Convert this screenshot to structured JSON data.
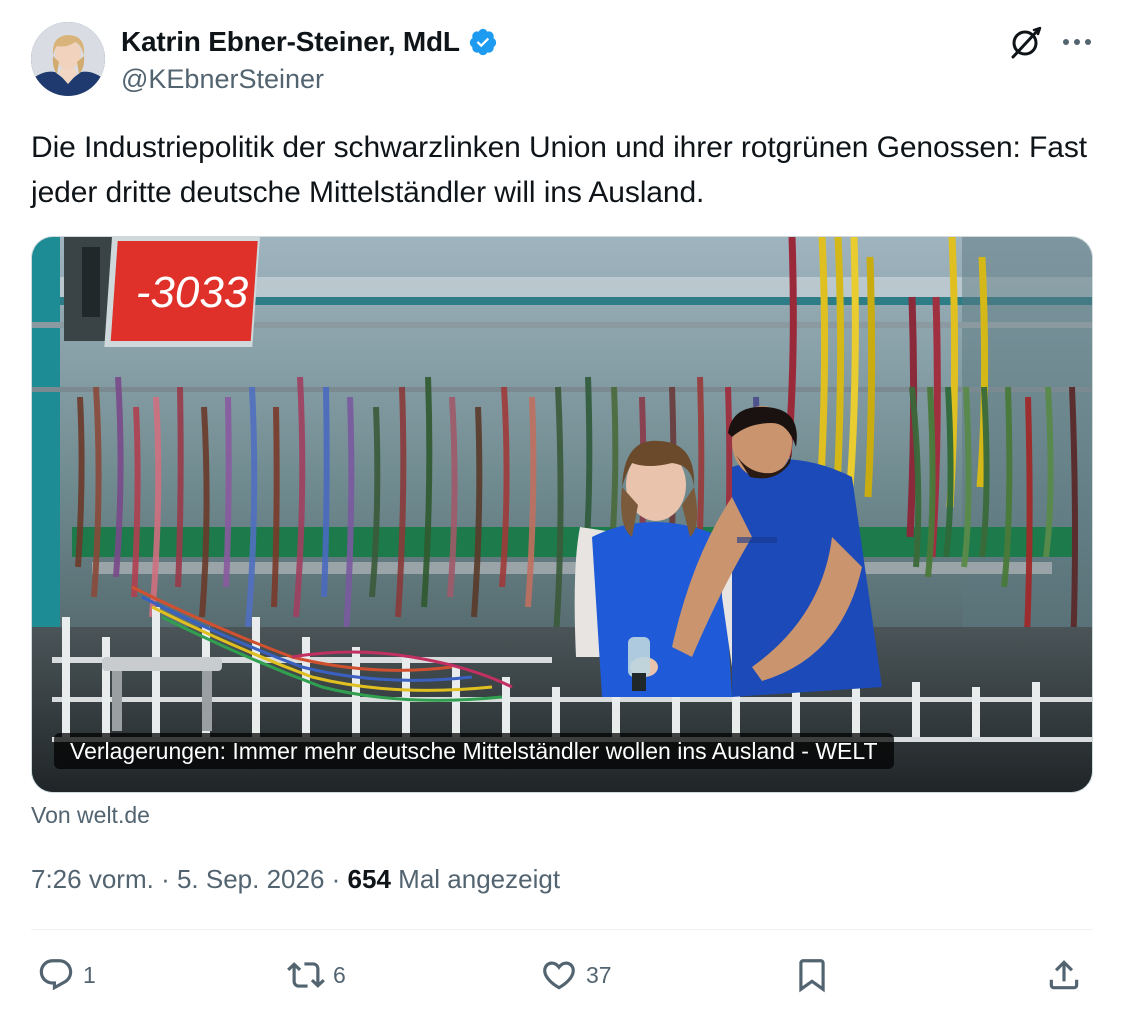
{
  "author": {
    "display_name": "Katrin Ebner-Steiner, MdL",
    "handle": "@KEbnerSteiner",
    "verified": true
  },
  "tweet": {
    "text": "Die Industriepolitik der schwarzlinken Union und ihrer rotgrünen Genossen: Fast jeder dritte deutsche Mittelständler will ins Ausland."
  },
  "link_card": {
    "caption": "Verlagerungen: Immer mehr deutsche Mittelständler wollen ins Ausland - WELT",
    "source": "Von welt.de",
    "sign_number": "-3033"
  },
  "meta": {
    "time": "7:26 vorm.",
    "date": "5. Sep. 2026",
    "views": "654",
    "views_label": "Mal angezeigt"
  },
  "actions": {
    "replies": "1",
    "reposts": "6",
    "likes": "37"
  },
  "colors": {
    "text_primary": "#0f1419",
    "text_secondary": "#536471",
    "verified_blue": "#1d9bf0",
    "divider": "#eff3f4"
  },
  "icons": {
    "verified": "verified-badge-icon",
    "grok": "grok-icon",
    "more": "more-options-icon",
    "reply": "reply-icon",
    "repost": "repost-icon",
    "like": "heart-icon",
    "bookmark": "bookmark-icon",
    "share": "share-icon"
  }
}
